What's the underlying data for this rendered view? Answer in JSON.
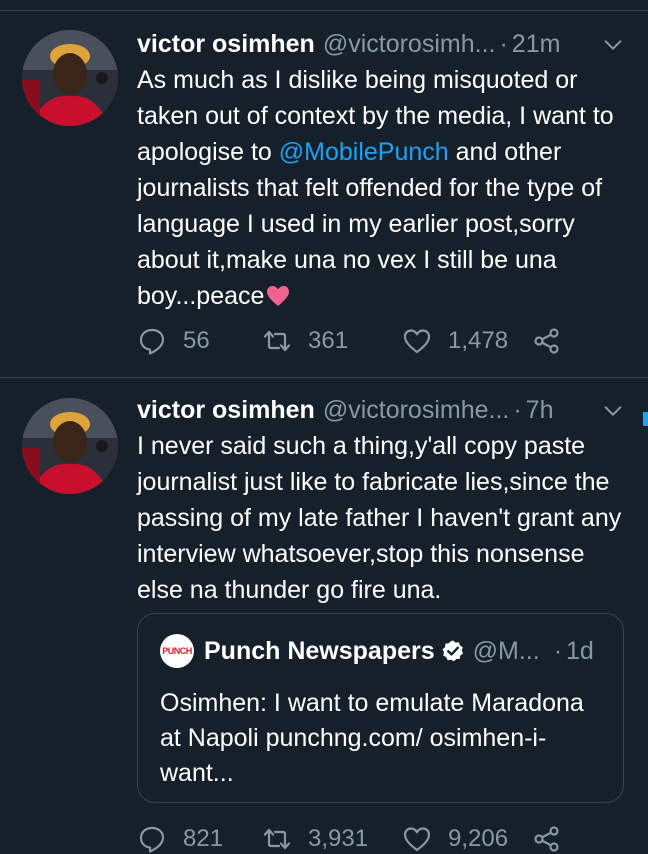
{
  "colors": {
    "background": "#15202b",
    "secondary_text": "#8899a6",
    "link": "#1da1f2",
    "divider": "#38444d",
    "heart_emoji": "#f06292"
  },
  "tweets": [
    {
      "display_name": "victor osimhen",
      "handle": "@victorosimh...",
      "separator": "·",
      "time": "21m",
      "text_before_mention": "As much as I dislike being misquoted or taken out of context by the media, I want to apologise to ",
      "mention": "@MobilePunch",
      "text_after_mention": " and other journalists that felt offended for the type of language I used in my earlier post,sorry about it,make una no vex I still be una boy...peace",
      "emoji": "pink-heart",
      "replies": "56",
      "retweets": "361",
      "likes": "1,478"
    },
    {
      "display_name": "victor osimhen",
      "handle": "@victorosimhe...",
      "separator": "·",
      "time": "7h",
      "text": "I never said such a thing,y'all copy paste journalist just like to fabricate lies,since the passing of my late father  I haven't grant any interview whatsoever,stop this nonsense else na thunder go fire una.",
      "quote": {
        "avatar_text": "PUNCH",
        "display_name": "Punch Newspapers",
        "handle": "@M...",
        "separator": "·",
        "time": "1d",
        "text": "Osimhen: I want to emulate Maradona at Napoli punchng.com/ osimhen-i-want..."
      },
      "replies": "821",
      "retweets": "3,931",
      "likes": "9,206"
    }
  ],
  "icons": [
    "chevron-down-icon",
    "reply-icon",
    "retweet-icon",
    "like-icon",
    "share-icon",
    "verified-badge-icon",
    "pink-heart-emoji"
  ]
}
